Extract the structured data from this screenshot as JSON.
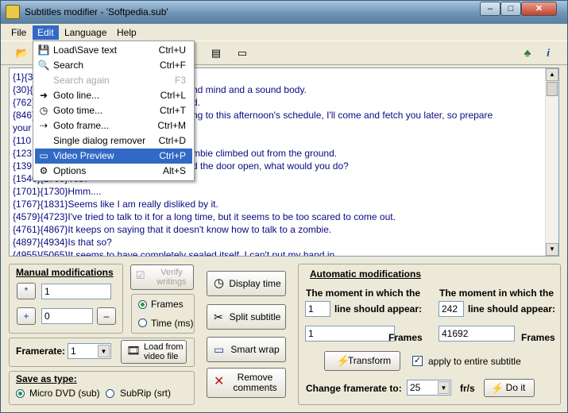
{
  "window": {
    "title": "Subtitles modifier - 'Softpedia.sub'",
    "min": "–",
    "max": "□",
    "close": "✕"
  },
  "menubar": [
    "File",
    "Edit",
    "Language",
    "Help"
  ],
  "edit_menu": [
    {
      "label": "Load\\Save text",
      "shortcut": "Ctrl+U",
      "icon": "load-save-icon",
      "disabled": false
    },
    {
      "label": "Search",
      "shortcut": "Ctrl+F",
      "icon": "search-icon",
      "disabled": false
    },
    {
      "label": "Search again",
      "shortcut": "F3",
      "icon": "",
      "disabled": true
    },
    {
      "label": "Goto line...",
      "shortcut": "Ctrl+L",
      "icon": "arrow-right-icon",
      "disabled": false
    },
    {
      "label": "Goto time...",
      "shortcut": "Ctrl+T",
      "icon": "clock-icon",
      "disabled": false
    },
    {
      "label": "Goto frame...",
      "shortcut": "Ctrl+M",
      "icon": "frame-arrow-icon",
      "disabled": false
    },
    {
      "label": "Single dialog remover",
      "shortcut": "Ctrl+D",
      "icon": "",
      "disabled": false
    },
    {
      "label": "Video Preview",
      "shortcut": "Ctrl+P",
      "icon": "monitor-icon",
      "disabled": false,
      "highlighted": true
    },
    {
      "label": "Options",
      "shortcut": "Alt+S",
      "icon": "gear-icon",
      "disabled": false
    }
  ],
  "subtitle_lines": [
    "{1}{3",
    "{30}{",
    "{762}",
    "{846}",
    "your",
    "{110",
    "{123",
    "{139",
    "{1540}{1700}Yes?",
    "{1701}{1730}Hmm....",
    "{1767}{1831}Seems like I am really disliked by it.",
    "{4579}{4723}I've tried to talk to it for a long time, but it seems to be too scared to come out.",
    "{4761}{4867}It keeps on saying that it doesn't know how to talk to a zombie.",
    "{4897}{4934}Is that so?",
    "{4955}{5065}It seems to have completely sealed itself. I can't put my hand in."
  ],
  "subtitle_right_fragments": [
    {
      "row": 1,
      "text": "nd mind and a sound body."
    },
    {
      "row": 2,
      "text": "d."
    },
    {
      "row": 3,
      "text": "ng to this afternoon's schedule, I'll come and fetch you later, so prepare"
    },
    {
      "row": 6,
      "text": "mbie climbed out from the ground."
    },
    {
      "row": 7,
      "text": "d the door open, what would you do?"
    }
  ],
  "manual": {
    "title": "Manual modifications",
    "field1": "1",
    "field2": "0",
    "btn_star": "*",
    "btn_plus": "+",
    "btn_minus": "–",
    "verify": "Verify writings",
    "frames": "Frames",
    "time_ms": "Time (ms)"
  },
  "framerate": {
    "label": "Framerate:",
    "value": "1",
    "load_btn": "Load from video file"
  },
  "save_as": {
    "title": "Save as type:",
    "opt1": "Micro DVD (sub)",
    "opt2": "SubRip (srt)"
  },
  "actions": {
    "display_time": "Display time",
    "split": "Split subtitle",
    "smart_wrap": "Smart wrap",
    "remove_comments": "Remove comments"
  },
  "auto": {
    "title": "Automatic modifications",
    "moment1": "The moment in which the",
    "moment2": "The moment in which the",
    "appear": "line should appear:",
    "field_a": "1",
    "field_b": "242",
    "field_c": "1",
    "field_d": "41692",
    "frames_a": "Frames",
    "frames_b": "Frames",
    "transform": "Transform",
    "apply_entire": "apply to entire subtitle",
    "change_fr": "Change framerate to:",
    "fr_value": "25",
    "frs": "fr/s",
    "do_it": "Do it"
  }
}
